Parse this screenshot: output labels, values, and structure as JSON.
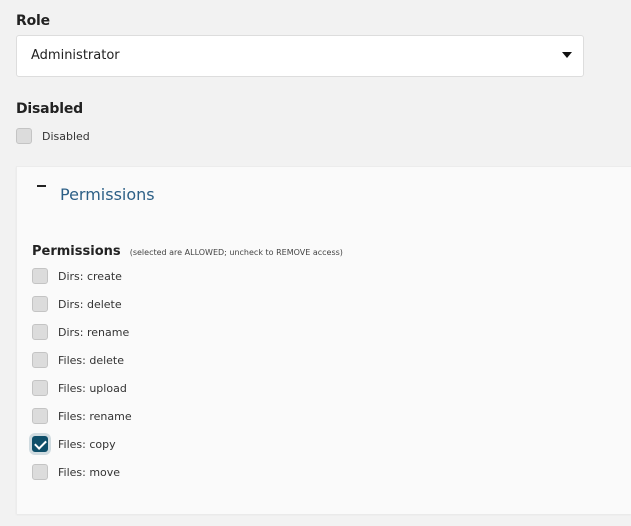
{
  "role": {
    "label": "Role",
    "selected": "Administrator"
  },
  "disabled": {
    "label": "Disabled",
    "checkbox_label": "Disabled",
    "checked": false
  },
  "permissions_panel": {
    "title": "Permissions",
    "collapse_symbol": "−",
    "header": "Permissions",
    "note": "(selected are ALLOWED; uncheck to REMOVE access)",
    "items": [
      {
        "label": "Dirs: create",
        "checked": false
      },
      {
        "label": "Dirs: delete",
        "checked": false
      },
      {
        "label": "Dirs: rename",
        "checked": false
      },
      {
        "label": "Files: delete",
        "checked": false
      },
      {
        "label": "Files: upload",
        "checked": false
      },
      {
        "label": "Files: rename",
        "checked": false
      },
      {
        "label": "Files: copy",
        "checked": true
      },
      {
        "label": "Files: move",
        "checked": false
      }
    ]
  },
  "colors": {
    "accent": "#0f4f6a",
    "title": "#2c5f86",
    "background": "#f2f2f2"
  },
  "icons": {
    "select_caret": "caret-down-icon",
    "collapse": "minus-icon",
    "check": "checkmark-icon"
  }
}
